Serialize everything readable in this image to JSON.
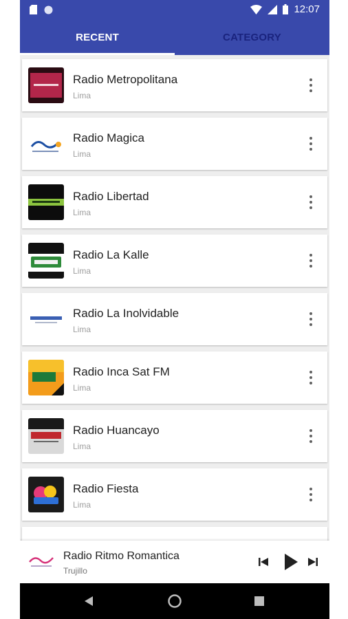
{
  "status_bar": {
    "time": "12:07",
    "icons": [
      "sd-card-icon",
      "circle-icon",
      "wifi-icon",
      "signal-icon",
      "battery-icon"
    ]
  },
  "tabs": [
    {
      "label": "RECENT",
      "selected": true
    },
    {
      "label": "CATEGORY",
      "selected": false
    }
  ],
  "stations": [
    {
      "name": "Radio Metropolitana",
      "city": "Lima",
      "logo": "metropolitana-logo"
    },
    {
      "name": "Radio Magica",
      "city": "Lima",
      "logo": "magica-logo"
    },
    {
      "name": "Radio Libertad",
      "city": "Lima",
      "logo": "libertad-logo"
    },
    {
      "name": "Radio La Kalle",
      "city": "Lima",
      "logo": "la-kalle-logo"
    },
    {
      "name": "Radio La Inolvidable",
      "city": "Lima",
      "logo": "la-inolvidable-logo"
    },
    {
      "name": "Radio Inca Sat FM",
      "city": "Lima",
      "logo": "inca-sat-logo"
    },
    {
      "name": "Radio Huancayo",
      "city": "Lima",
      "logo": "huancayo-logo"
    },
    {
      "name": "Radio Fiesta",
      "city": "Lima",
      "logo": "fiesta-logo"
    }
  ],
  "player": {
    "title": "Radio Ritmo Romantica",
    "subtitle": "Trujillo",
    "controls": [
      "skip-previous-icon",
      "play-icon",
      "skip-next-icon"
    ]
  },
  "colors": {
    "primary": "#3949ab",
    "tab_inactive": "#1a237e",
    "background": "#eeeeee"
  }
}
